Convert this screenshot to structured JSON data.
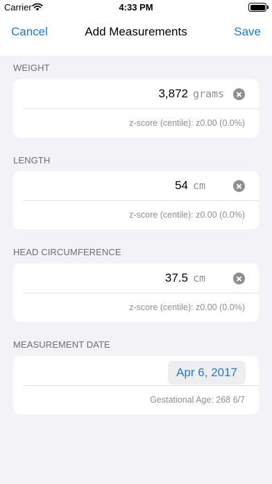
{
  "status": {
    "carrier": "Carrier",
    "time": "4:33 PM"
  },
  "nav": {
    "cancel": "Cancel",
    "title": "Add Measurements",
    "save": "Save"
  },
  "weight": {
    "label": "WEIGHT",
    "value": "3,872",
    "unit": "grams",
    "zscore": "z-score (centile): z0.00 (0.0%)"
  },
  "length": {
    "label": "LENGTH",
    "value": "54",
    "unit": "cm",
    "zscore": "z-score (centile): z0.00 (0.0%)"
  },
  "head": {
    "label": "HEAD CIRCUMFERENCE",
    "value": "37.5",
    "unit": "cm",
    "zscore": "z-score (centile): z0.00 (0.0%)"
  },
  "date": {
    "label": "MEASUREMENT DATE",
    "value": "Apr 6, 2017",
    "gestational": "Gestational Age: 268 6/7"
  },
  "colors": {
    "accent": "#1a7ad8",
    "background": "#f2f2f7",
    "secondary_text": "#8e8e93"
  },
  "icons": {
    "wifi": "wifi-icon",
    "battery": "battery-icon",
    "clear": "clear-icon"
  }
}
